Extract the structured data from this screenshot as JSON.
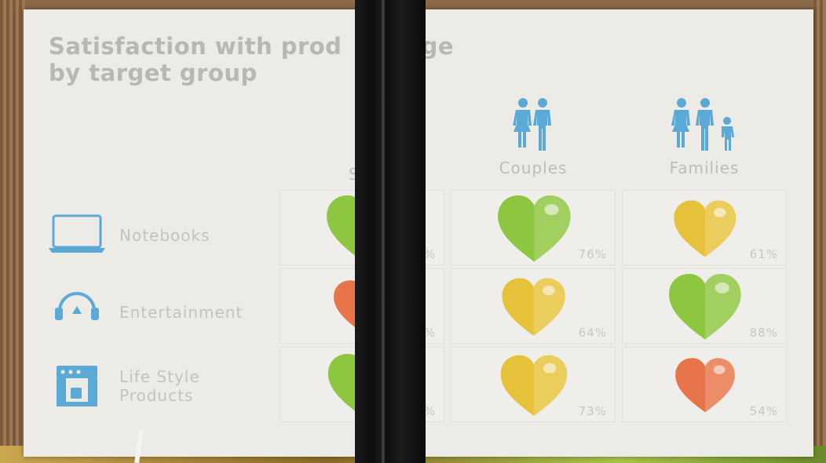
{
  "title_line1": "Satisfaction with prod",
  "title_line1_end": "ange",
  "title_line2": "by target group",
  "columns": [
    {
      "label": "Sin",
      "icon": "single-person-icon"
    },
    {
      "label": "Couples",
      "icon": "couple-icon"
    },
    {
      "label": "Families",
      "icon": "family-icon"
    }
  ],
  "rows": [
    {
      "label": "Notebooks",
      "icon": "laptop-icon"
    },
    {
      "label": "Entertainment",
      "icon": "headphones-icon"
    },
    {
      "label": "Life Style\nProducts",
      "icon": "coffee-machine-icon"
    }
  ],
  "cells": [
    [
      {
        "pct": "%",
        "color": "#8dc63f",
        "level": 0.9
      },
      {
        "pct": "76%",
        "color": "#8dc63f",
        "level": 0.9
      },
      {
        "pct": "61%",
        "color": "#e6c23a",
        "level": 0.61
      }
    ],
    [
      {
        "pct": "%",
        "color": "#e8744a",
        "level": 0.5
      },
      {
        "pct": "64%",
        "color": "#e6c23a",
        "level": 0.64
      },
      {
        "pct": "88%",
        "color": "#8dc63f",
        "level": 0.88
      }
    ],
    [
      {
        "pct": "%",
        "color": "#8dc63f",
        "level": 0.8
      },
      {
        "pct": "73%",
        "color": "#e6c23a",
        "level": 0.73
      },
      {
        "pct": "54%",
        "color": "#e8744a",
        "level": 0.54
      }
    ]
  ],
  "colors": {
    "icon_blue": "#5aa9d6",
    "green": "#8dc63f",
    "yellow": "#e6c23a",
    "orange": "#e8744a"
  }
}
